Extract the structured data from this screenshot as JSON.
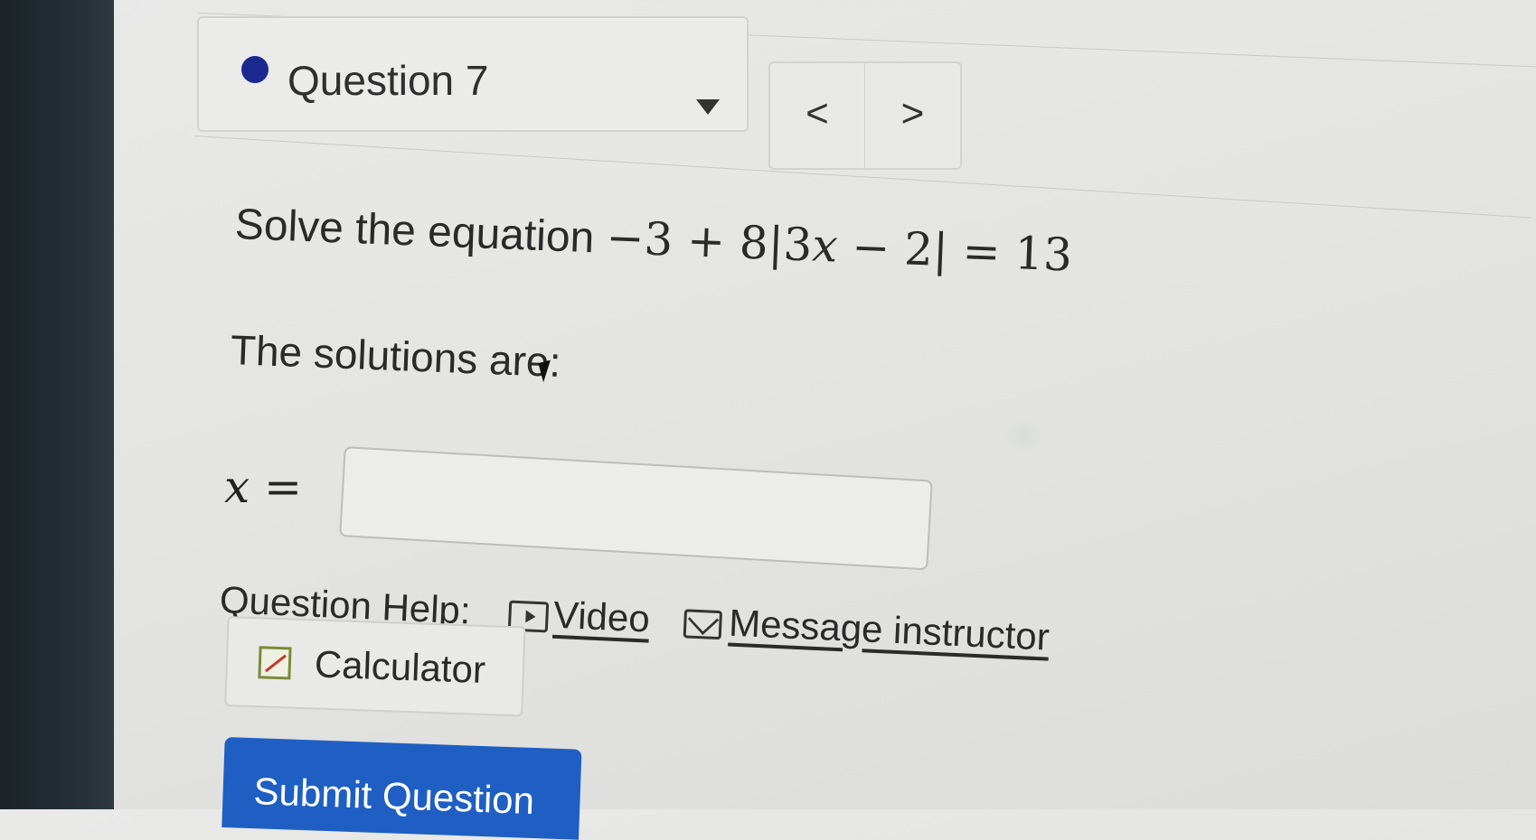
{
  "question_select": {
    "label": "Question 7",
    "status_color": "#1c2a8f"
  },
  "nav": {
    "prev": "<",
    "next": ">"
  },
  "question": {
    "prompt_text": "Solve the equation",
    "equation": "−3 + 8|3𝑥 − 2| = 13",
    "solutions_text": "The solutions are:",
    "answer_label": "𝑥 =",
    "answer_value": ""
  },
  "help": {
    "label": "Question Help:",
    "video": "Video",
    "message": "Message instructor",
    "calculator": "Calculator"
  },
  "submit": {
    "label": "Submit Question",
    "color": "#1f5fc4"
  }
}
